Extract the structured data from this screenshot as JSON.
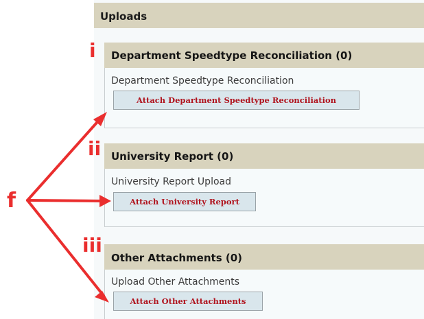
{
  "uploads": {
    "title": "Uploads"
  },
  "sections": [
    {
      "title": "Department Speedtype Reconciliation (0)",
      "description": "Department Speedtype Reconciliation",
      "button_label": "Attach Department Speedtype Reconciliation"
    },
    {
      "title": "University Report (0)",
      "description": "University Report Upload",
      "button_label": "Attach University Report"
    },
    {
      "title": "Other Attachments (0)",
      "description": "Upload Other Attachments",
      "button_label": "Attach Other Attachments"
    }
  ],
  "annotations": {
    "markers": [
      "i",
      "ii",
      "iii"
    ],
    "source_label": "f",
    "color": "#ea2e2e"
  }
}
